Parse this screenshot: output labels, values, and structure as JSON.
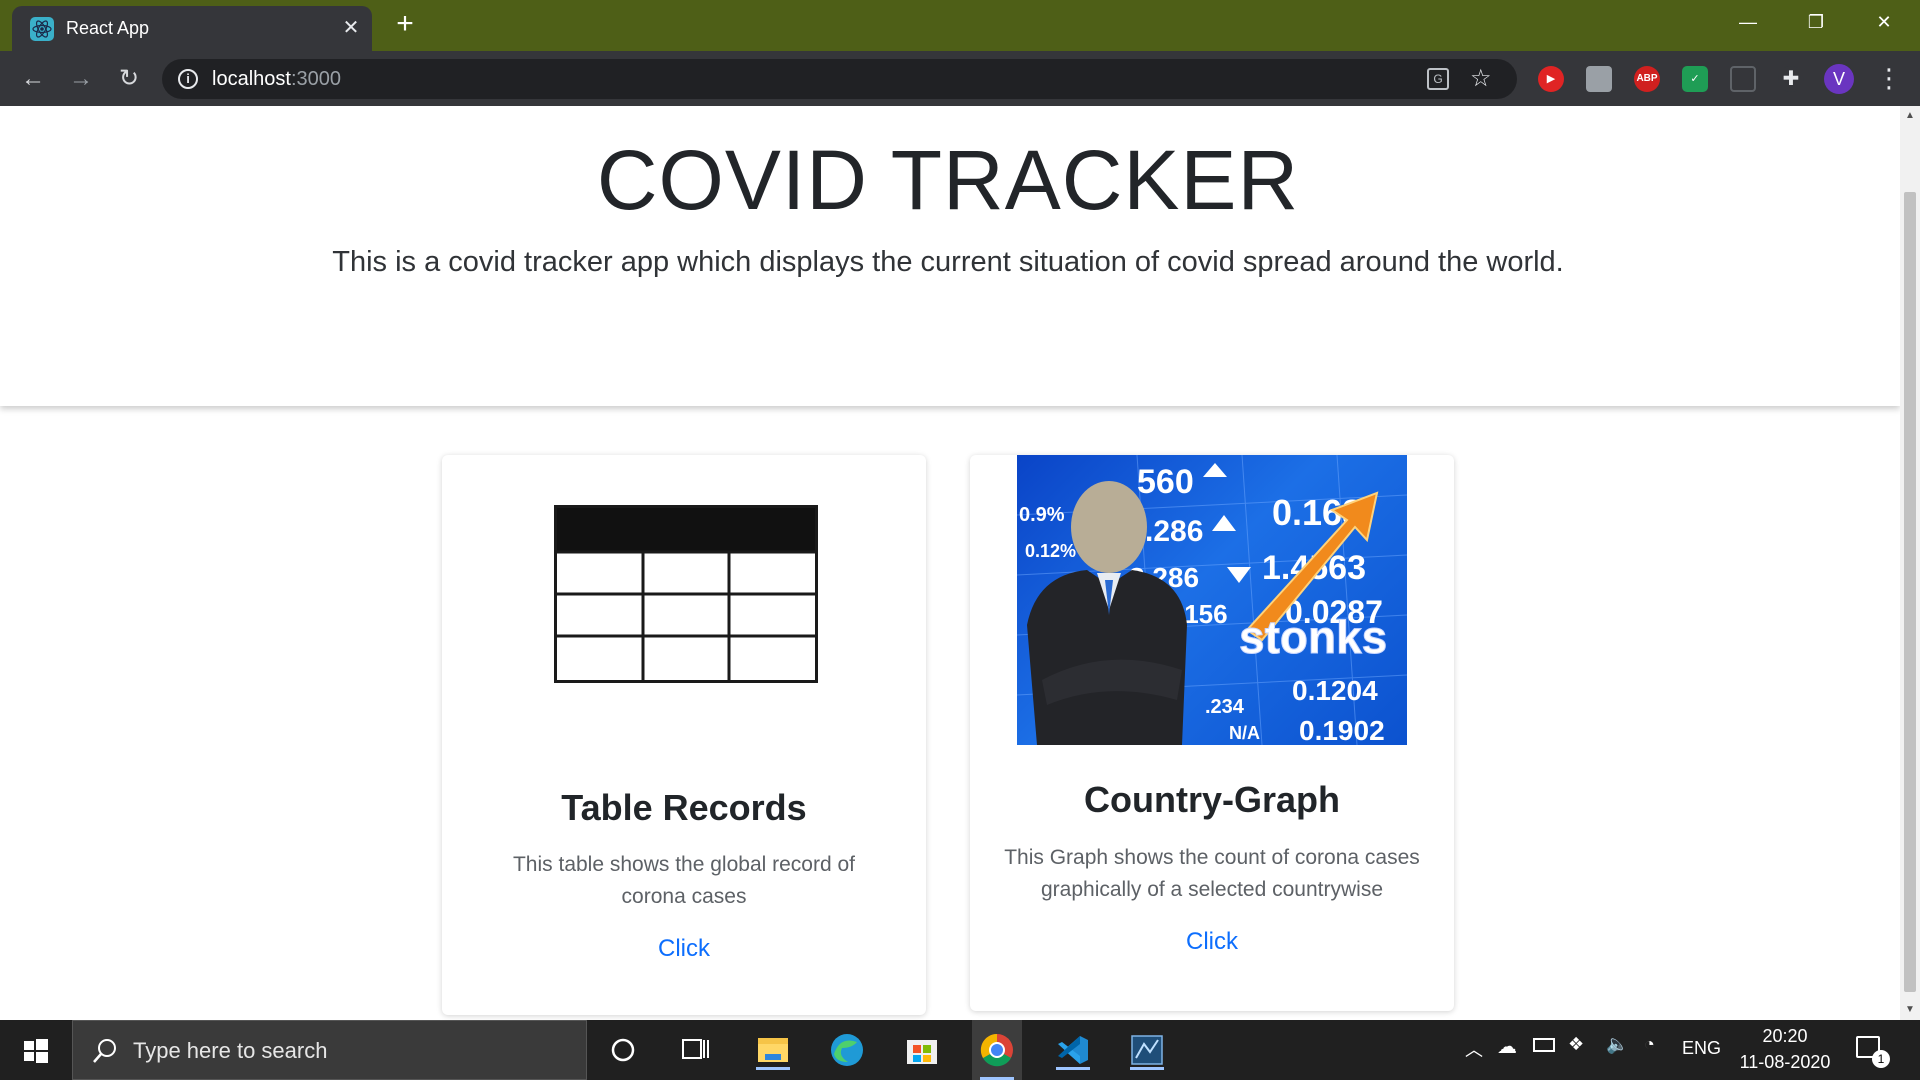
{
  "browser": {
    "tab_title": "React App",
    "tab_close": "✕",
    "new_tab": "+",
    "url_host": "localhost",
    "url_port": ":3000",
    "window_controls": {
      "minimize": "—",
      "restore": "❐",
      "close": "✕"
    },
    "extensions": [
      "ABP"
    ],
    "avatar_letter": "V"
  },
  "page": {
    "title": "COVID TRACKER",
    "subtitle": "This is a covid tracker app which displays the current situation of covid spread around the world."
  },
  "cards": [
    {
      "title": "Table Records",
      "text": "This table shows the global record of corona cases",
      "link": "Click",
      "image": "table-icon"
    },
    {
      "title": "Country-Graph",
      "text": "This Graph shows the count of corona cases graphically of a selected countrywise",
      "link": "Click",
      "image": "stonks-meme-image",
      "image_text": {
        "caption": "stonks",
        "numbers": [
          "560",
          "0.168",
          ".286",
          "1.4563",
          "2.286",
          "0.0287",
          ".156",
          "0.1204",
          "0.1902",
          "0.9%",
          "0.12%",
          ".234",
          "N/A"
        ]
      }
    }
  ],
  "taskbar": {
    "search_placeholder": "Type here to search",
    "language": "ENG",
    "time": "20:20",
    "date": "11-08-2020",
    "notification_count": "1"
  },
  "colors": {
    "tabbar": "#4e5f17",
    "toolbar": "#35363a",
    "link": "#0d6efd",
    "taskbar": "#202020"
  }
}
